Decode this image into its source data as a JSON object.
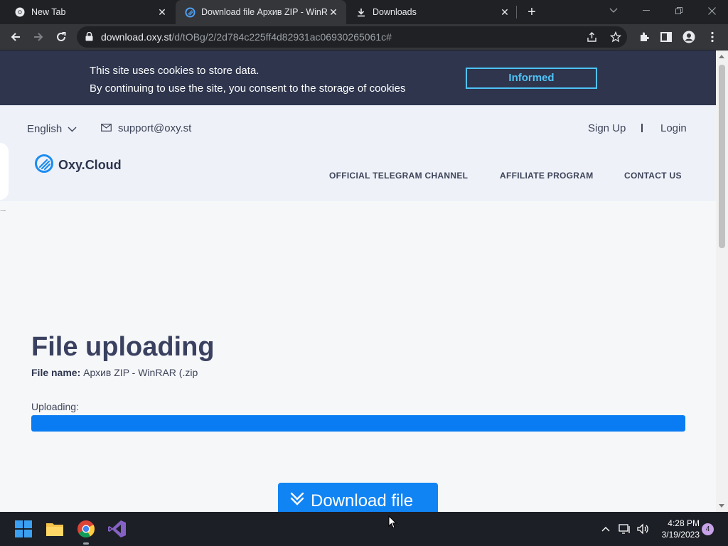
{
  "browser": {
    "tabs": [
      {
        "title": "New Tab",
        "active": false,
        "icon": "chrome-icon"
      },
      {
        "title": "Download file Архив ZIP - WinRAR",
        "active": true,
        "icon": "oxy-cloud-icon"
      },
      {
        "title": "Downloads",
        "active": false,
        "icon": "download-icon"
      }
    ],
    "url_host": "download.oxy.st",
    "url_path": "/d/tOBg/2/2d784c225ff4d82931ac06930265061c#"
  },
  "cookie_banner": {
    "line1": "This site uses cookies to store data.",
    "line2": "By continuing to use the site, you consent to the storage of cookies",
    "button": "Informed"
  },
  "header": {
    "language": "English",
    "support_email": "support@oxy.st",
    "sign_up": "Sign Up",
    "login": "Login",
    "logo_text": "Oxy.Cloud",
    "nav": [
      "OFFICIAL TELEGRAM CHANNEL",
      "AFFILIATE PROGRAM",
      "CONTACT US"
    ]
  },
  "main": {
    "title": "File uploading",
    "file_name_label": "File name:",
    "file_name": "Архив ZIP - WinRAR (.zip",
    "uploading_label": "Uploading:",
    "progress_fraction": 1.0,
    "download_button": "Download file",
    "ellipsis": "..."
  },
  "taskbar": {
    "time": "4:28 PM",
    "date": "3/19/2023",
    "notification_count": "4"
  },
  "colors": {
    "cookie_bg": "#2e354d",
    "accent_blue": "#1184f4",
    "cookie_button": "#4fc3f7"
  }
}
